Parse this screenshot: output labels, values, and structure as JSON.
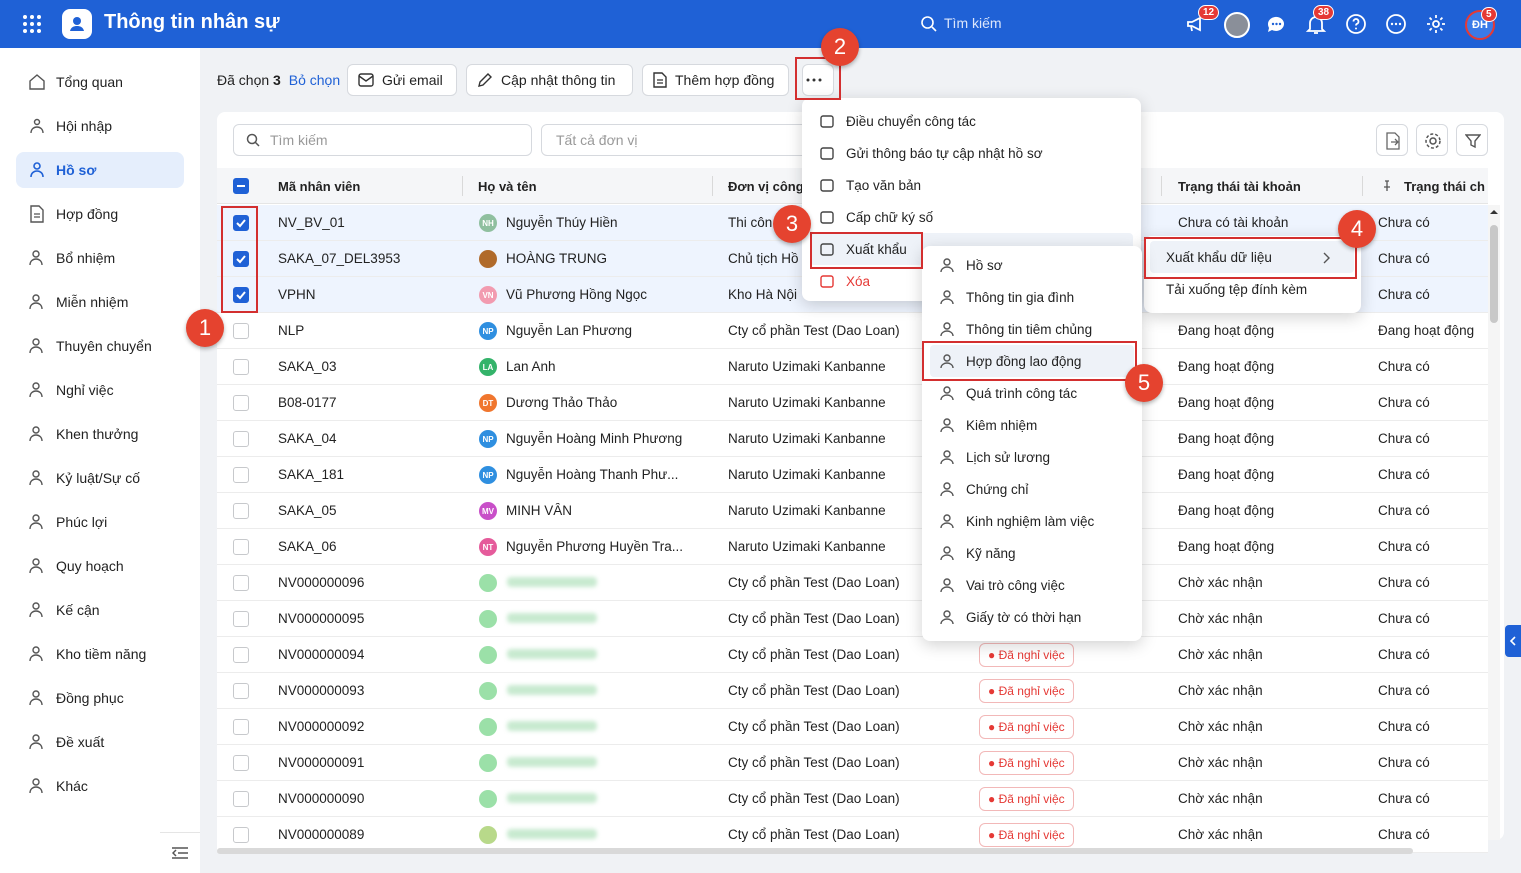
{
  "app": {
    "title": "Thông tin nhân sự",
    "search_placeholder": "Tìm kiếm",
    "badges": {
      "megaphone": "12",
      "bell": "38",
      "avatar": "5"
    },
    "avatar_initials": "ĐH"
  },
  "sidebar": {
    "items": [
      {
        "label": "Tổng quan",
        "icon": "home-icon"
      },
      {
        "label": "Hội nhập",
        "icon": "people-icon"
      },
      {
        "label": "Hồ sơ",
        "icon": "user-icon",
        "active": true
      },
      {
        "label": "Hợp đồng",
        "icon": "document-icon"
      },
      {
        "label": "Bổ nhiệm",
        "icon": "user-plus-icon"
      },
      {
        "label": "Miễn nhiệm",
        "icon": "user-minus-icon"
      },
      {
        "label": "Thuyên chuyển",
        "icon": "transfer-icon"
      },
      {
        "label": "Nghỉ việc",
        "icon": "user-x-icon"
      },
      {
        "label": "Khen thưởng",
        "icon": "reward-icon"
      },
      {
        "label": "Kỷ luật/Sự cố",
        "icon": "shield-icon"
      },
      {
        "label": "Phúc lợi",
        "icon": "benefit-icon"
      },
      {
        "label": "Quy hoạch",
        "icon": "planning-icon"
      },
      {
        "label": "Kế cận",
        "icon": "org-icon"
      },
      {
        "label": "Kho tiềm năng",
        "icon": "talent-icon"
      },
      {
        "label": "Đồng phục",
        "icon": "shirt-icon"
      },
      {
        "label": "Đề xuất",
        "icon": "proposal-icon"
      },
      {
        "label": "Khác",
        "icon": "more-icon"
      }
    ]
  },
  "actionbar": {
    "selected_prefix": "Đã chọn",
    "selected_count": "3",
    "deselect": "Bỏ chọn",
    "send_email": "Gửi email",
    "update_info": "Cập nhật thông tin",
    "add_contract": "Thêm hợp đồng"
  },
  "filters": {
    "search_placeholder": "Tìm kiếm",
    "unit_placeholder": "Tất cả đơn vị"
  },
  "table": {
    "columns": [
      "Mã nhân viên",
      "Họ và tên",
      "Đơn vị công",
      "Trạng thái tài khoản",
      "Trạng thái ch"
    ],
    "rows": [
      {
        "id": "NV_BV_01",
        "name": "Nguyễn Thúy Hiền",
        "av": "NH",
        "avc": "#8fbf9f",
        "unit": "Thi côn",
        "status": "Chưa có tài khoản",
        "st2": "Chưa có",
        "checked": true
      },
      {
        "id": "SAKA_07_DEL3953",
        "name": "HOÀNG TRUNG",
        "av": "",
        "avc": "#b06a2a",
        "unit": "Chủ tịch Hồ",
        "status": "",
        "st2": "Chưa có",
        "checked": true
      },
      {
        "id": "VPHN",
        "name": "Vũ Phương Hồng Ngọc",
        "av": "VN",
        "avc": "#f29bb0",
        "unit": "Kho Hà Nội",
        "status": "",
        "st2": "Chưa có",
        "checked": true
      },
      {
        "id": "NLP",
        "name": "Nguyễn Lan Phương",
        "av": "NP",
        "avc": "#2f8fe0",
        "unit": "Cty cổ phần Test (Dao Loan)",
        "status": "Đang hoạt động",
        "st2": "Đang hoạt động"
      },
      {
        "id": "SAKA_03",
        "name": "Lan Anh",
        "av": "LA",
        "avc": "#34b36a",
        "unit": "Naruto Uzimaki Kanbanne",
        "status": "Đang hoạt động",
        "st2": "Chưa có"
      },
      {
        "id": "B08-0177",
        "name": "Dương Thảo Thảo",
        "av": "DT",
        "avc": "#f0762e",
        "unit": "Naruto Uzimaki Kanbanne",
        "status": "Đang hoạt động",
        "st2": "Chưa có"
      },
      {
        "id": "SAKA_04",
        "name": "Nguyễn Hoàng Minh Phương",
        "av": "NP",
        "avc": "#2f8fe0",
        "unit": "Naruto Uzimaki Kanbanne",
        "status": "Đang hoạt động",
        "st2": "Chưa có"
      },
      {
        "id": "SAKA_181",
        "name": "Nguyễn Hoàng Thanh Phư...",
        "av": "NP",
        "avc": "#2f8fe0",
        "unit": "Naruto Uzimaki Kanbanne",
        "status": "Đang hoạt động",
        "st2": "Chưa có"
      },
      {
        "id": "SAKA_05",
        "name": "MINH VÂN",
        "av": "MV",
        "avc": "#c84fc8",
        "unit": "Naruto Uzimaki Kanbanne",
        "status": "Đang hoạt động",
        "st2": "Chưa có"
      },
      {
        "id": "SAKA_06",
        "name": "Nguyễn Phương Huyền Tra...",
        "av": "NT",
        "avc": "#e55b9b",
        "unit": "Naruto Uzimaki Kanbanne",
        "status": "Đang hoạt động",
        "st2": "Chưa có"
      },
      {
        "id": "NV000000096",
        "name": "",
        "av": "",
        "avc": "#9be0a8",
        "unit": "Cty cổ phần Test (Dao Loan)",
        "status": "Chờ xác nhận",
        "st2": "Chưa có",
        "blur": true
      },
      {
        "id": "NV000000095",
        "name": "",
        "av": "",
        "avc": "#9be0a8",
        "unit": "Cty cổ phần Test (Dao Loan)",
        "status": "Chờ xác nhận",
        "st2": "Chưa có",
        "blur": true
      },
      {
        "id": "NV000000094",
        "name": "",
        "av": "",
        "avc": "#9be0a8",
        "unit": "Cty cổ phần Test (Dao Loan)",
        "status": "Chờ xác nhận",
        "st2": "Chưa có",
        "blur": true,
        "tag": "Đã nghỉ việc"
      },
      {
        "id": "NV000000093",
        "name": "",
        "av": "",
        "avc": "#9be0a8",
        "unit": "Cty cổ phần Test (Dao Loan)",
        "status": "Chờ xác nhận",
        "st2": "Chưa có",
        "blur": true,
        "tag": "Đã nghỉ việc"
      },
      {
        "id": "NV000000092",
        "name": "",
        "av": "",
        "avc": "#9be0a8",
        "unit": "Cty cổ phần Test (Dao Loan)",
        "status": "Chờ xác nhận",
        "st2": "Chưa có",
        "blur": true,
        "tag": "Đã nghỉ việc"
      },
      {
        "id": "NV000000091",
        "name": "",
        "av": "",
        "avc": "#9be0a8",
        "unit": "Cty cổ phần Test (Dao Loan)",
        "status": "Chờ xác nhận",
        "st2": "Chưa có",
        "blur": true,
        "tag": "Đã nghỉ việc"
      },
      {
        "id": "NV000000090",
        "name": "",
        "av": "",
        "avc": "#9be0a8",
        "unit": "Cty cổ phần Test (Dao Loan)",
        "status": "Chờ xác nhận",
        "st2": "Chưa có",
        "blur": true,
        "tag": "Đã nghỉ việc"
      },
      {
        "id": "NV000000089",
        "name": "",
        "av": "",
        "avc": "#b8d98a",
        "unit": "Cty cổ phần Test (Dao Loan)",
        "status": "Chờ xác nhận",
        "st2": "Chưa có",
        "blur": true,
        "tag": "Đã nghỉ việc"
      }
    ]
  },
  "more_menu": {
    "items": [
      "Điều chuyển công tác",
      "Gửi thông báo tự cập nhật hồ sơ",
      "Tạo văn bản",
      "Cấp chữ ký số",
      "Xuất khẩu",
      "Xóa"
    ]
  },
  "export_menu": {
    "items": [
      "Xuất khẩu dữ liệu",
      "Tải xuống tệp đính kèm"
    ]
  },
  "data_menu": {
    "items": [
      "Hồ sơ",
      "Thông tin gia đình",
      "Thông tin tiêm chủng",
      "Hợp đồng lao động",
      "Quá trình công tác",
      "Kiêm nhiệm",
      "Lịch sử lương",
      "Chứng chỉ",
      "Kinh nghiệm làm việc",
      "Kỹ năng",
      "Vai trò công việc",
      "Giấy tờ có thời hạn"
    ]
  },
  "step_markers": [
    "1",
    "2",
    "3",
    "4",
    "5"
  ],
  "colors": {
    "primary": "#1f61d6",
    "danger": "#e53935",
    "marker": "#e5432f"
  }
}
